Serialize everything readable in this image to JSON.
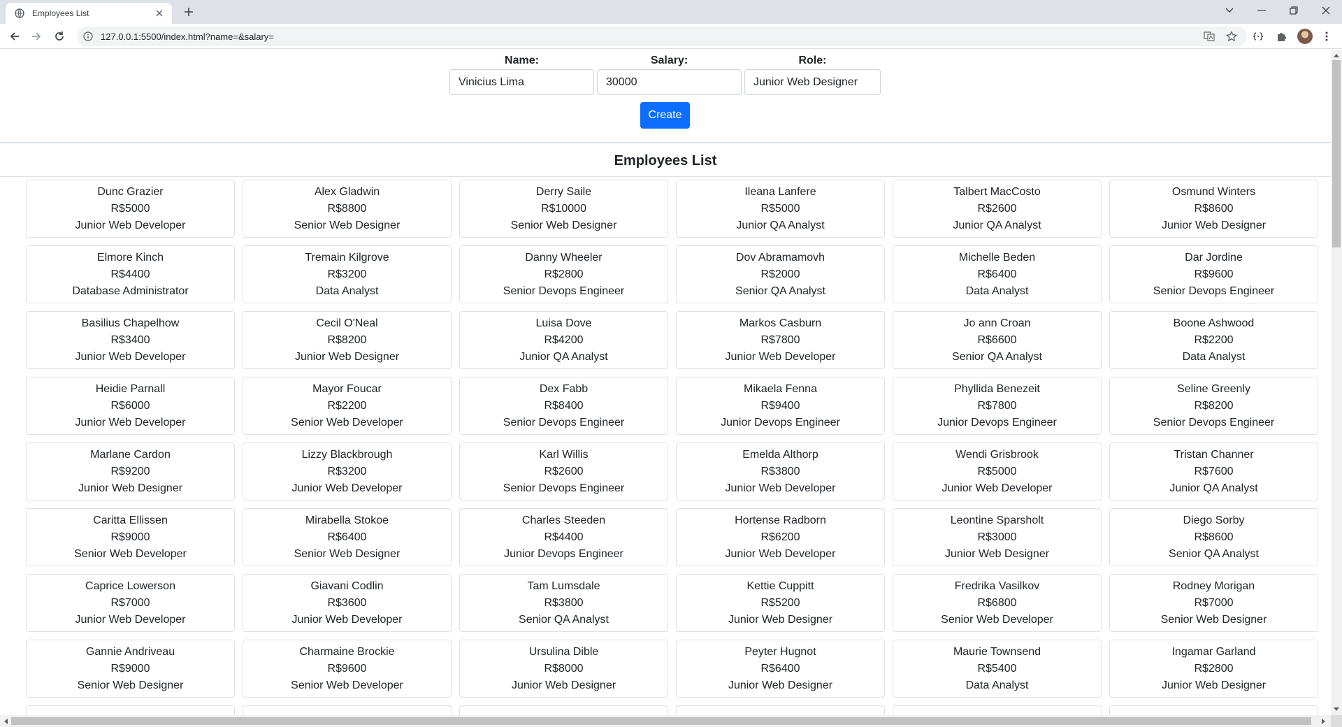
{
  "browser": {
    "tab_title": "Employees List",
    "url": "127.0.0.1:5500/index.html?name=&salary="
  },
  "form": {
    "name_label": "Name:",
    "name_value": "Vinicius Lima",
    "salary_label": "Salary:",
    "salary_value": "30000",
    "role_label": "Role:",
    "role_value": "Junior Web Designer",
    "create_label": "Create"
  },
  "list_title": "Employees List",
  "employees": [
    {
      "name": "Dunc Grazier",
      "salary": "R$5000",
      "role": "Junior Web Developer"
    },
    {
      "name": "Alex Gladwin",
      "salary": "R$8800",
      "role": "Senior Web Designer"
    },
    {
      "name": "Derry Saile",
      "salary": "R$10000",
      "role": "Senior Web Designer"
    },
    {
      "name": "Ileana Lanfere",
      "salary": "R$5000",
      "role": "Junior QA Analyst"
    },
    {
      "name": "Talbert MacCosto",
      "salary": "R$2600",
      "role": "Junior QA Analyst"
    },
    {
      "name": "Osmund Winters",
      "salary": "R$8600",
      "role": "Junior Web Designer"
    },
    {
      "name": "Elmore Kinch",
      "salary": "R$4400",
      "role": "Database Administrator"
    },
    {
      "name": "Tremain Kilgrove",
      "salary": "R$3200",
      "role": "Data Analyst"
    },
    {
      "name": "Danny Wheeler",
      "salary": "R$2800",
      "role": "Senior Devops Engineer"
    },
    {
      "name": "Dov Abramamovh",
      "salary": "R$2000",
      "role": "Senior QA Analyst"
    },
    {
      "name": "Michelle Beden",
      "salary": "R$6400",
      "role": "Data Analyst"
    },
    {
      "name": "Dar Jordine",
      "salary": "R$9600",
      "role": "Senior Devops Engineer"
    },
    {
      "name": "Basilius Chapelhow",
      "salary": "R$3400",
      "role": "Junior Web Developer"
    },
    {
      "name": "Cecil O'Neal",
      "salary": "R$8200",
      "role": "Junior Web Designer"
    },
    {
      "name": "Luisa Dove",
      "salary": "R$4200",
      "role": "Junior QA Analyst"
    },
    {
      "name": "Markos Casburn",
      "salary": "R$7800",
      "role": "Junior Web Developer"
    },
    {
      "name": "Jo ann Croan",
      "salary": "R$6600",
      "role": "Senior QA Analyst"
    },
    {
      "name": "Boone Ashwood",
      "salary": "R$2200",
      "role": "Data Analyst"
    },
    {
      "name": "Heidie Parnall",
      "salary": "R$6000",
      "role": "Junior Web Developer"
    },
    {
      "name": "Mayor Foucar",
      "salary": "R$2200",
      "role": "Senior Web Developer"
    },
    {
      "name": "Dex Fabb",
      "salary": "R$8400",
      "role": "Senior Devops Engineer"
    },
    {
      "name": "Mikaela Fenna",
      "salary": "R$9400",
      "role": "Junior Devops Engineer"
    },
    {
      "name": "Phyllida Benezeit",
      "salary": "R$7800",
      "role": "Junior Devops Engineer"
    },
    {
      "name": "Seline Greenly",
      "salary": "R$8200",
      "role": "Senior Devops Engineer"
    },
    {
      "name": "Marlane Cardon",
      "salary": "R$9200",
      "role": "Junior Web Designer"
    },
    {
      "name": "Lizzy Blackbrough",
      "salary": "R$3200",
      "role": "Junior Web Developer"
    },
    {
      "name": "Karl Willis",
      "salary": "R$2600",
      "role": "Senior Devops Engineer"
    },
    {
      "name": "Emelda Althorp",
      "salary": "R$3800",
      "role": "Junior Web Developer"
    },
    {
      "name": "Wendi Grisbrook",
      "salary": "R$5000",
      "role": "Junior Web Developer"
    },
    {
      "name": "Tristan Channer",
      "salary": "R$7600",
      "role": "Junior QA Analyst"
    },
    {
      "name": "Caritta Ellissen",
      "salary": "R$9000",
      "role": "Senior Web Developer"
    },
    {
      "name": "Mirabella Stokoe",
      "salary": "R$6400",
      "role": "Senior Web Designer"
    },
    {
      "name": "Charles Steeden",
      "salary": "R$4400",
      "role": "Junior Devops Engineer"
    },
    {
      "name": "Hortense Radborn",
      "salary": "R$6200",
      "role": "Junior Web Developer"
    },
    {
      "name": "Leontine Sparsholt",
      "salary": "R$3000",
      "role": "Junior Web Designer"
    },
    {
      "name": "Diego Sorby",
      "salary": "R$8600",
      "role": "Senior QA Analyst"
    },
    {
      "name": "Caprice Lowerson",
      "salary": "R$7000",
      "role": "Junior Web Developer"
    },
    {
      "name": "Giavani Codlin",
      "salary": "R$3600",
      "role": "Junior Web Developer"
    },
    {
      "name": "Tam Lumsdale",
      "salary": "R$3800",
      "role": "Senior QA Analyst"
    },
    {
      "name": "Kettie Cuppitt",
      "salary": "R$5200",
      "role": "Junior Web Designer"
    },
    {
      "name": "Fredrika Vasilkov",
      "salary": "R$6800",
      "role": "Senior Web Developer"
    },
    {
      "name": "Rodney Morigan",
      "salary": "R$7000",
      "role": "Senior Web Designer"
    },
    {
      "name": "Gannie Andriveau",
      "salary": "R$9000",
      "role": "Senior Web Designer"
    },
    {
      "name": "Charmaine Brockie",
      "salary": "R$9600",
      "role": "Senior Web Developer"
    },
    {
      "name": "Ursulina Dible",
      "salary": "R$8000",
      "role": "Junior Web Designer"
    },
    {
      "name": "Peyter Hugnot",
      "salary": "R$6400",
      "role": "Junior Web Designer"
    },
    {
      "name": "Maurie Townsend",
      "salary": "R$5400",
      "role": "Data Analyst"
    },
    {
      "name": "Ingamar Garland",
      "salary": "R$2800",
      "role": "Junior Web Designer"
    }
  ],
  "partial_row_count": 6
}
